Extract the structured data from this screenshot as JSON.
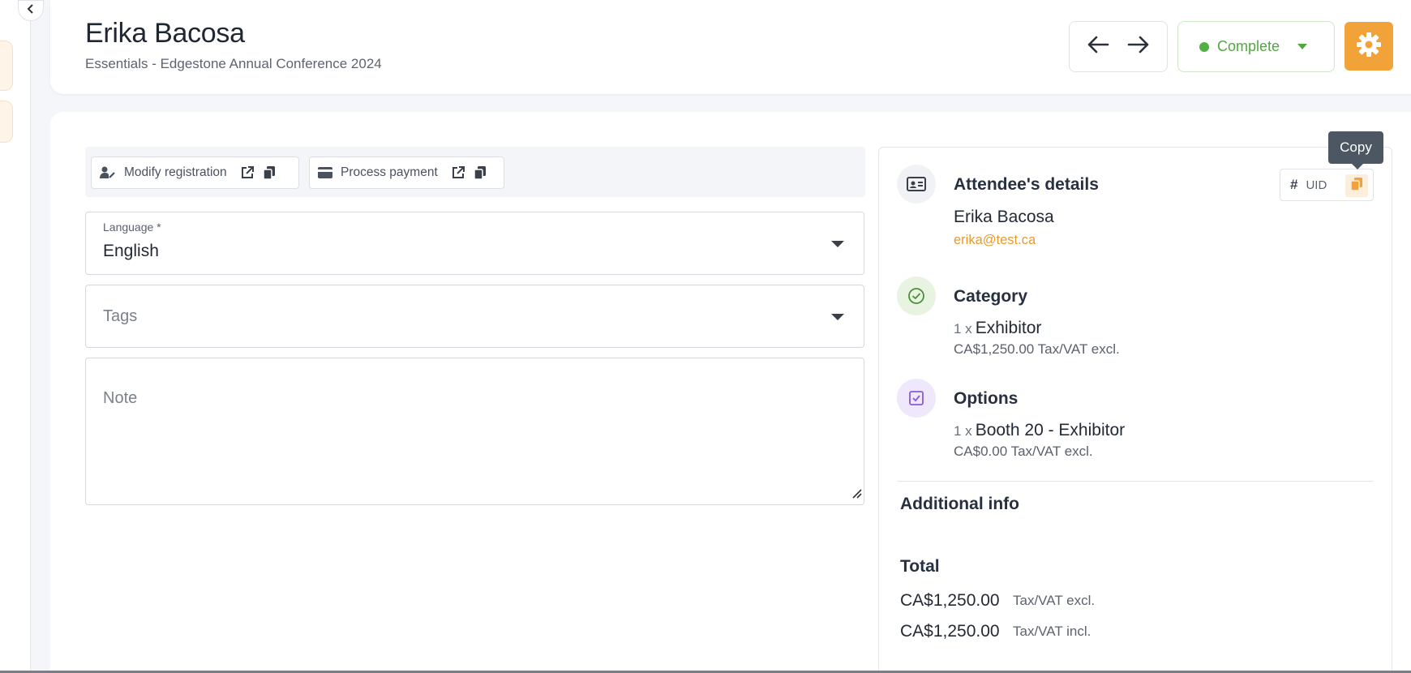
{
  "header": {
    "title": "Erika Bacosa",
    "subtitle": "Essentials - Edgestone Annual Conference 2024",
    "status_label": "Complete",
    "status_color": "#52b043",
    "accent_color": "#f1a33a"
  },
  "actions": {
    "modify_label": "Modify registration",
    "payment_label": "Process payment"
  },
  "form": {
    "language_label": "Language *",
    "language_value": "English",
    "tags_placeholder": "Tags",
    "note_placeholder": "Note"
  },
  "details": {
    "attendee_title": "Attendee's details",
    "uid_hash": "#",
    "uid_label": "UID",
    "tooltip": "Copy",
    "attendee_name": "Erika Bacosa",
    "attendee_email": "erika@test.ca",
    "category_title": "Category",
    "category_qty": "1 x",
    "category_item": "Exhibitor",
    "category_price": "CA$1,250.00 Tax/VAT excl.",
    "options_title": "Options",
    "options_qty": "1 x",
    "options_item": "Booth 20 - Exhibitor",
    "options_price": "CA$0.00 Tax/VAT excl.",
    "additional_title": "Additional info",
    "total_title": "Total",
    "total_excl_amount": "CA$1,250.00",
    "total_excl_label": "Tax/VAT excl.",
    "total_incl_amount": "CA$1,250.00",
    "total_incl_label": "Tax/VAT incl."
  },
  "icons": [
    "chevron-left-icon",
    "arrow-left-icon",
    "arrow-right-icon",
    "gear-icon",
    "user-edit-icon",
    "external-link-icon",
    "copy-icon",
    "credit-card-icon",
    "id-card-icon",
    "check-circle-icon",
    "checkbox-icon"
  ]
}
